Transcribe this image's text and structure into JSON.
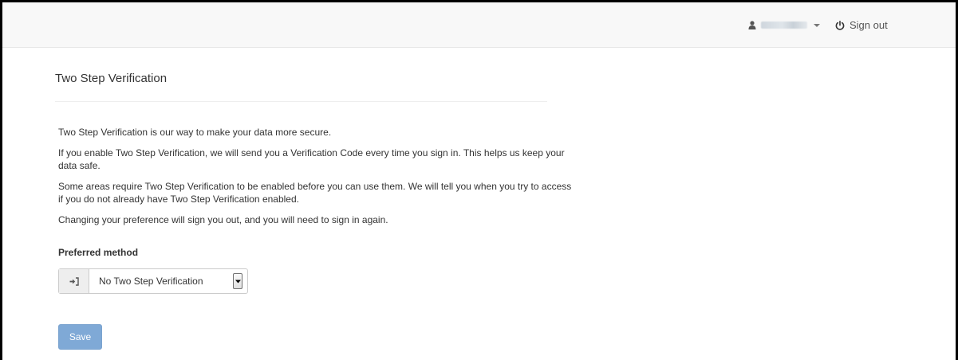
{
  "header": {
    "sign_out_label": "Sign out",
    "icons": {
      "user": "user-icon",
      "caret": "caret-down-icon",
      "power": "power-icon"
    }
  },
  "main": {
    "title": "Two Step Verification",
    "paragraphs": [
      "Two Step Verification is our way to make your data more secure.",
      "If you enable Two Step Verification, we will send you a Verification Code every time you sign in. This helps us keep your data safe.",
      "Some areas require Two Step Verification to be enabled before you can use them. We will tell you when you try to access if you do not already have Two Step Verification enabled.",
      "Changing your preference will sign you out, and you will need to sign in again."
    ],
    "preferred_method_label": "Preferred method",
    "preferred_method": {
      "icon": "sign-in-icon",
      "selected": "No Two Step Verification"
    },
    "save_label": "Save"
  },
  "colors": {
    "topbar_bg": "#f8f8f8",
    "save_button_bg": "#7fa9d6",
    "text": "#333333"
  }
}
